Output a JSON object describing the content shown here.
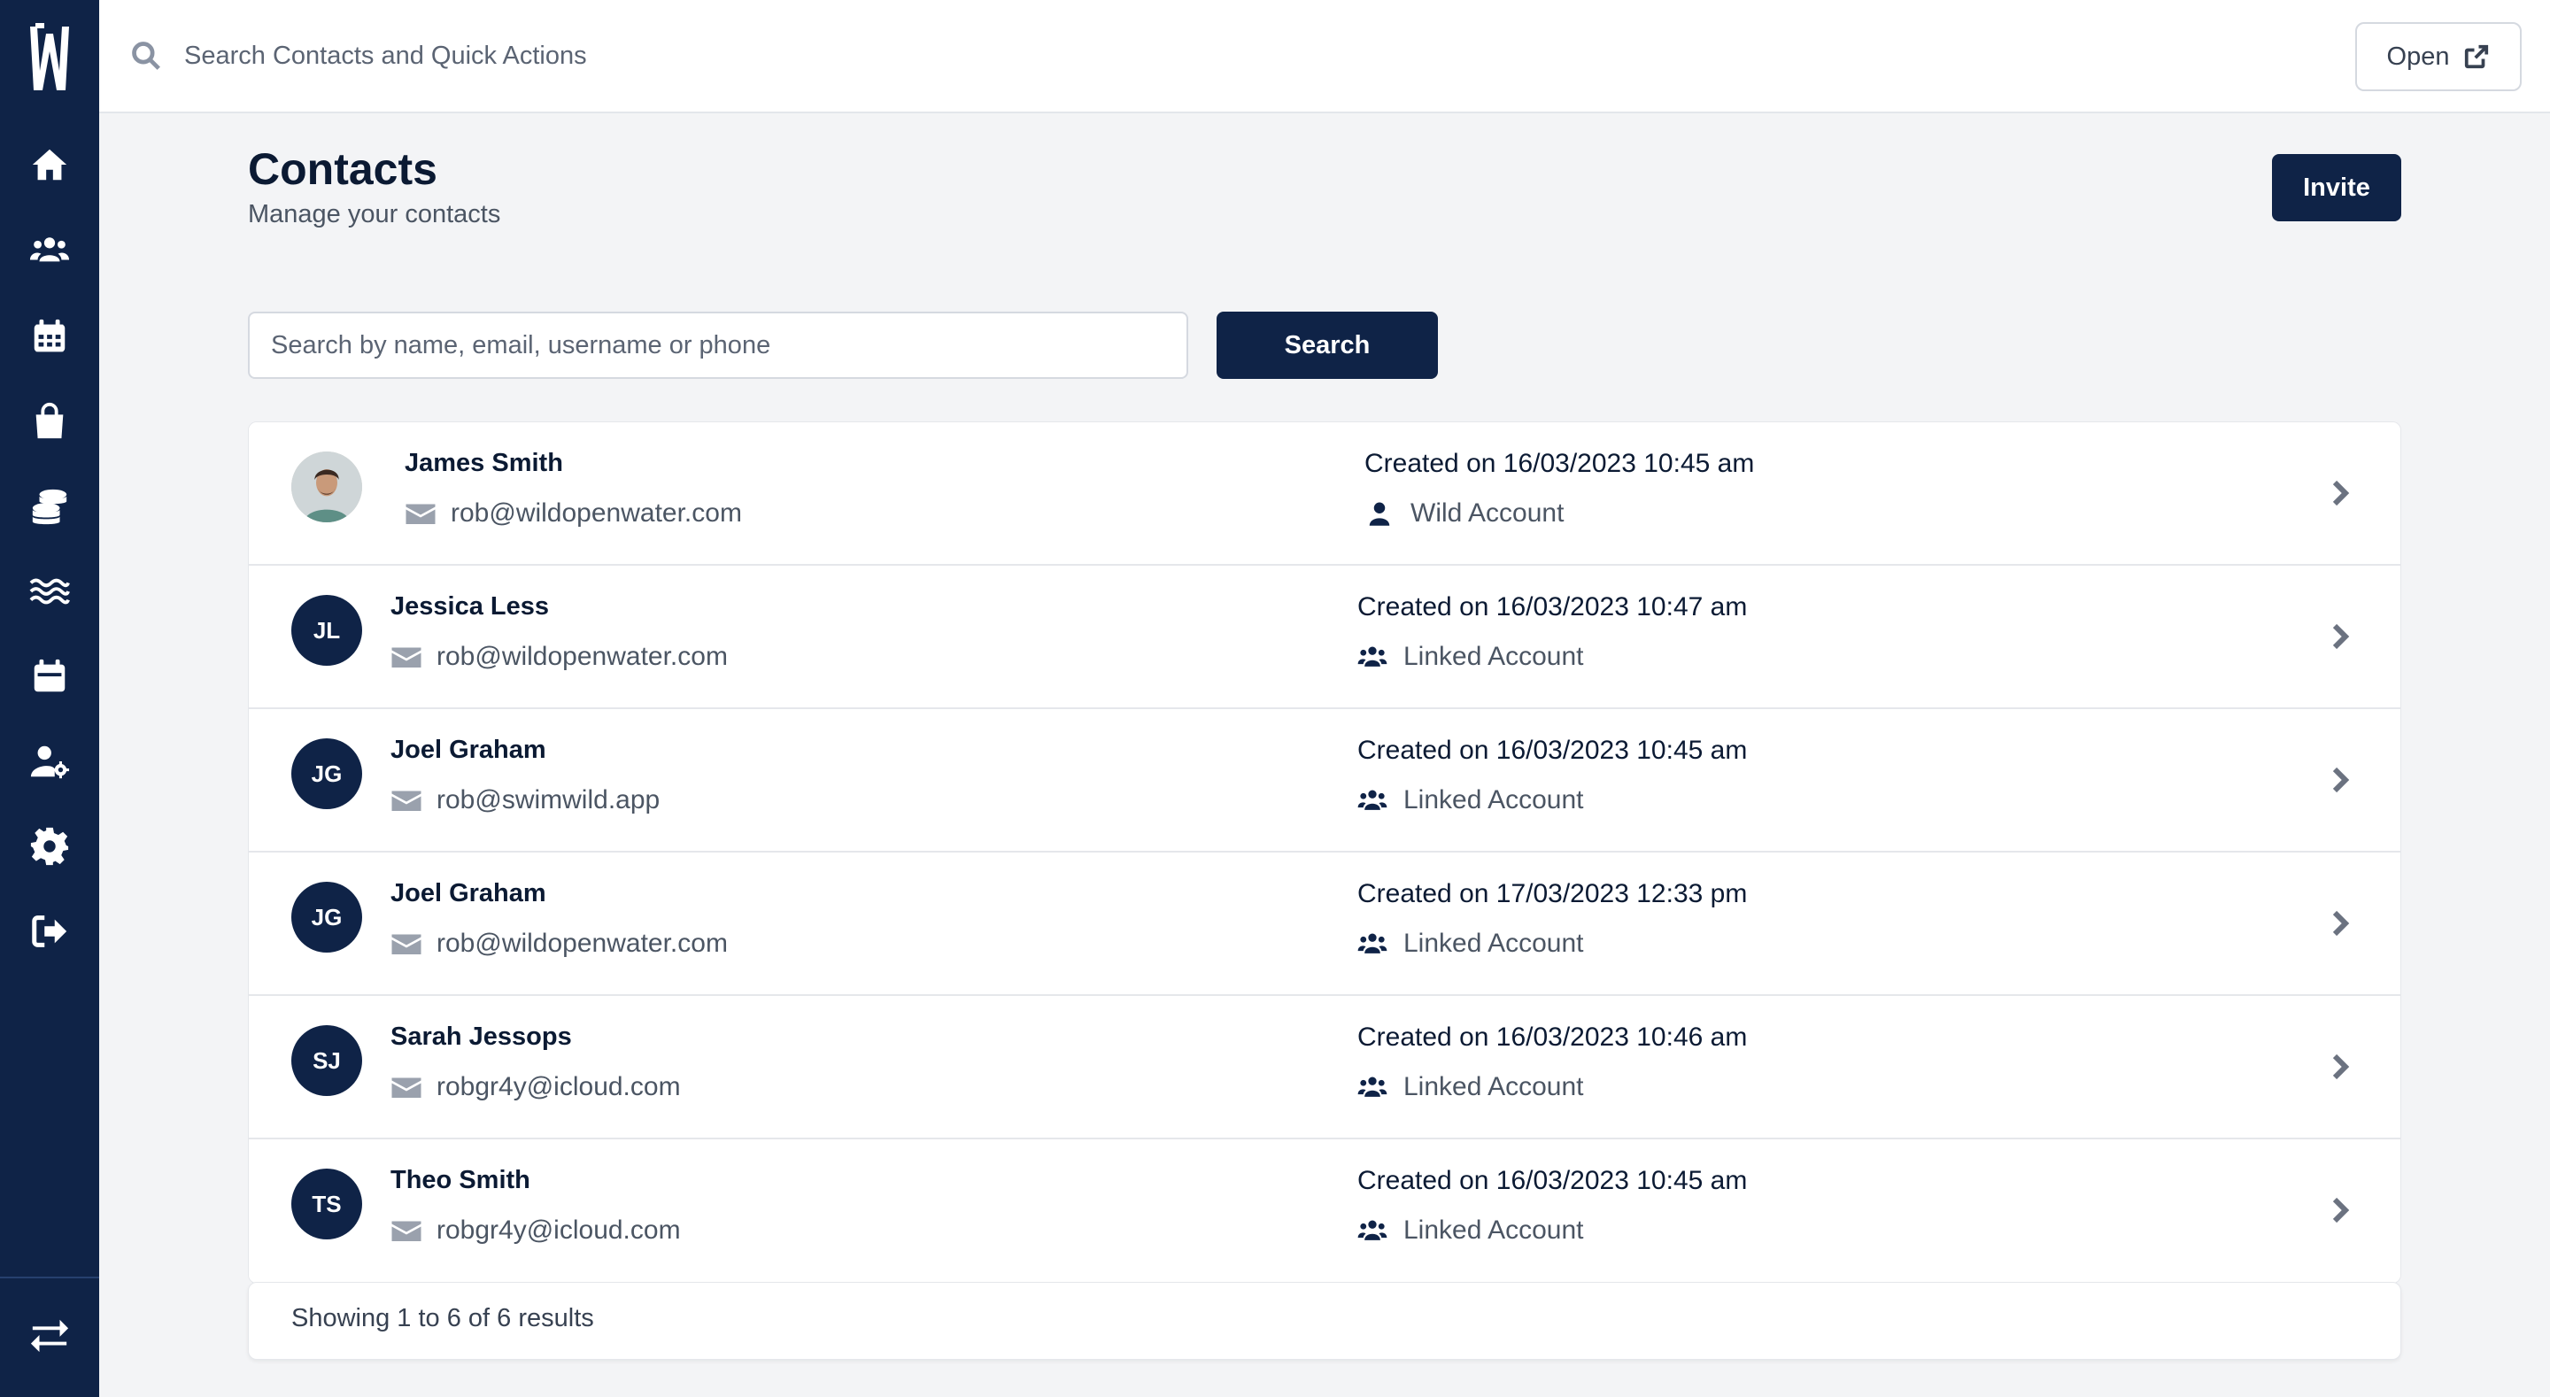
{
  "topbar": {
    "search_placeholder": "Search Contacts and Quick Actions",
    "open_label": "Open"
  },
  "header": {
    "title": "Contacts",
    "subtitle": "Manage your contacts",
    "invite_label": "Invite"
  },
  "search": {
    "placeholder": "Search by name, email, username or phone",
    "button_label": "Search"
  },
  "contacts": [
    {
      "initials": "",
      "name": "James Smith",
      "email": "rob@wildopenwater.com",
      "created": "Created on 16/03/2023 10:45 am",
      "account": "Wild Account",
      "account_icon": "user-icon",
      "avatar": "photo"
    },
    {
      "initials": "JL",
      "name": "Jessica Less",
      "email": "rob@wildopenwater.com",
      "created": "Created on 16/03/2023 10:47 am",
      "account": "Linked Account",
      "account_icon": "users-icon"
    },
    {
      "initials": "JG",
      "name": "Joel Graham",
      "email": "rob@swimwild.app",
      "created": "Created on 16/03/2023 10:45 am",
      "account": "Linked Account",
      "account_icon": "users-icon"
    },
    {
      "initials": "JG",
      "name": "Joel Graham",
      "email": "rob@wildopenwater.com",
      "created": "Created on 17/03/2023 12:33 pm",
      "account": "Linked Account",
      "account_icon": "users-icon"
    },
    {
      "initials": "SJ",
      "name": "Sarah Jessops",
      "email": "robgr4y@icloud.com",
      "created": "Created on 16/03/2023 10:46 am",
      "account": "Linked Account",
      "account_icon": "users-icon"
    },
    {
      "initials": "TS",
      "name": "Theo Smith",
      "email": "robgr4y@icloud.com",
      "created": "Created on 16/03/2023 10:45 am",
      "account": "Linked Account",
      "account_icon": "users-icon"
    }
  ],
  "footer": {
    "results_text": "Showing 1 to 6 of 6 results"
  },
  "sidebar": {
    "icons": [
      "home-icon",
      "people-icon",
      "calendar-icon",
      "shopping-bag-icon",
      "coins-icon",
      "water-icon",
      "calendar-event-icon",
      "user-settings-icon",
      "gear-icon",
      "logout-icon",
      "switch-icon"
    ]
  },
  "colors": {
    "sidebar": "#0f2347",
    "primary_button": "#0f2347",
    "background": "#f3f4f6"
  }
}
